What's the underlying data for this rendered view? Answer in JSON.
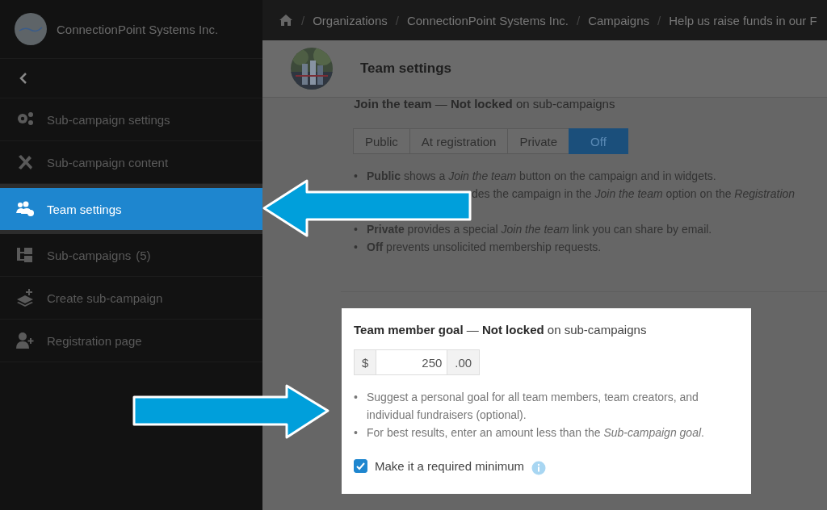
{
  "sidebar": {
    "org_name": "ConnectionPoint Systems Inc.",
    "items": [
      {
        "label": "Sub-campaign settings",
        "selected": false
      },
      {
        "label": "Sub-campaign content",
        "selected": false
      },
      {
        "label": "Team settings",
        "selected": true
      },
      {
        "label": "Sub-campaigns",
        "count": "(5)",
        "selected": false
      },
      {
        "label": "Create sub-campaign",
        "selected": false
      },
      {
        "label": "Registration page",
        "selected": false
      }
    ]
  },
  "breadcrumb_separator": "/",
  "breadcrumb": [
    "Organizations",
    "ConnectionPoint Systems Inc.",
    "Campaigns",
    "Help us raise funds in our F"
  ],
  "header": {
    "title": "Team settings"
  },
  "join_team": {
    "title": "**Join the team** — **Not locked** on sub-campaigns",
    "bullet": "•",
    "options": [
      {
        "label": "Public",
        "selected": false
      },
      {
        "label": "At registration",
        "selected": false
      },
      {
        "label": "Private",
        "selected": false
      },
      {
        "label": "Off",
        "selected": true
      }
    ],
    "notes": [
      {
        "kind": "bullet",
        "text": "**Public** shows a *Join the team* button on the campaign and in widgets."
      },
      {
        "kind": "covered",
        "text": "des the campaign in the *Join the team* option on the *Registration*"
      },
      {
        "kind": "bullet",
        "text": "**Private** provides a special *Join the team* link you can share by email."
      },
      {
        "kind": "bullet",
        "text": "**Off** prevents unsolicited membership requests."
      }
    ]
  },
  "member_goal": {
    "title": "**Team member goal** — **Not locked** on sub-campaigns",
    "bullet": "•",
    "currency": "$",
    "value": "250",
    "cents": ".00",
    "notes": [
      "Suggest a personal goal for all team members, team creators, and individual fundraisers (optional).",
      "For best results, enter an amount less than the *Sub-campaign goal*."
    ],
    "required": {
      "label": "Make it a required minimum",
      "checked": true
    }
  }
}
